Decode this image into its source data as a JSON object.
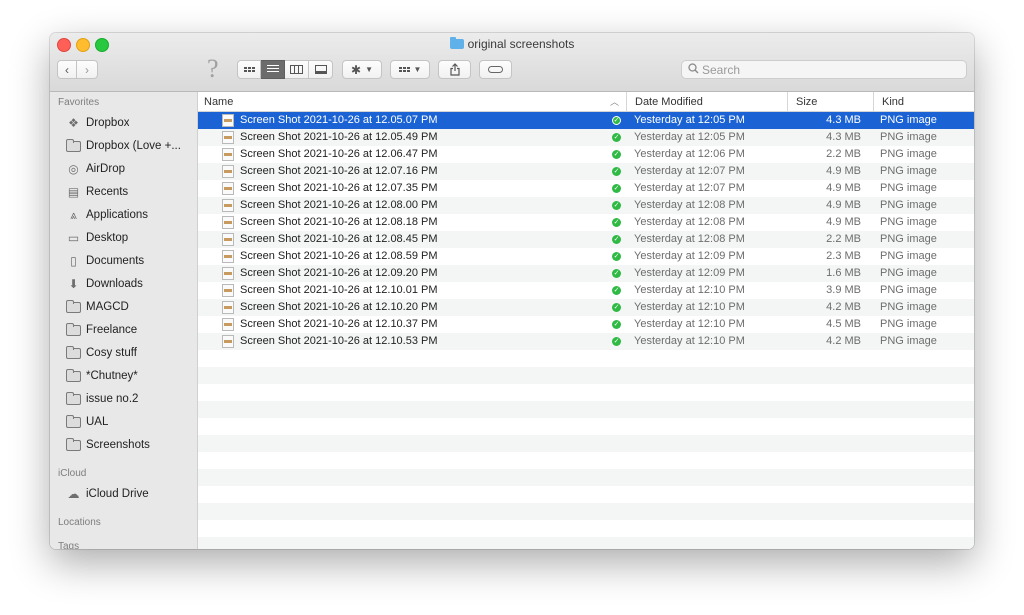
{
  "window": {
    "title": "original screenshots"
  },
  "toolbar": {
    "back_label": "‹",
    "forward_label": "›",
    "help_label": "?",
    "search_placeholder": "Search"
  },
  "sidebar": {
    "favorites_header": "Favorites",
    "favorites": [
      {
        "label": "Dropbox",
        "icon": "dropbox-icon"
      },
      {
        "label": "Dropbox (Love +...",
        "icon": "folder-icon"
      },
      {
        "label": "AirDrop",
        "icon": "airdrop-icon"
      },
      {
        "label": "Recents",
        "icon": "recents-icon"
      },
      {
        "label": "Applications",
        "icon": "applications-icon"
      },
      {
        "label": "Desktop",
        "icon": "desktop-icon"
      },
      {
        "label": "Documents",
        "icon": "documents-icon"
      },
      {
        "label": "Downloads",
        "icon": "downloads-icon"
      },
      {
        "label": "MAGCD",
        "icon": "folder-icon"
      },
      {
        "label": "Freelance",
        "icon": "folder-icon"
      },
      {
        "label": "Cosy stuff",
        "icon": "folder-icon"
      },
      {
        "label": "*Chutney*",
        "icon": "folder-icon"
      },
      {
        "label": "issue no.2",
        "icon": "folder-icon"
      },
      {
        "label": "UAL",
        "icon": "folder-icon"
      },
      {
        "label": "Screenshots",
        "icon": "folder-icon"
      }
    ],
    "icloud_header": "iCloud",
    "icloud": [
      {
        "label": "iCloud Drive",
        "icon": "cloud-icon"
      }
    ],
    "locations_header": "Locations",
    "tags_header": "Tags"
  },
  "columns": {
    "name": "Name",
    "date_modified": "Date Modified",
    "size": "Size",
    "kind": "Kind"
  },
  "files": [
    {
      "name": "Screen Shot 2021-10-26 at 12.05.07 PM",
      "date": "Yesterday at 12:05 PM",
      "size": "4.3 MB",
      "kind": "PNG image",
      "selected": true
    },
    {
      "name": "Screen Shot 2021-10-26 at 12.05.49 PM",
      "date": "Yesterday at 12:05 PM",
      "size": "4.3 MB",
      "kind": "PNG image"
    },
    {
      "name": "Screen Shot 2021-10-26 at 12.06.47 PM",
      "date": "Yesterday at 12:06 PM",
      "size": "2.2 MB",
      "kind": "PNG image"
    },
    {
      "name": "Screen Shot 2021-10-26 at 12.07.16 PM",
      "date": "Yesterday at 12:07 PM",
      "size": "4.9 MB",
      "kind": "PNG image"
    },
    {
      "name": "Screen Shot 2021-10-26 at 12.07.35 PM",
      "date": "Yesterday at 12:07 PM",
      "size": "4.9 MB",
      "kind": "PNG image"
    },
    {
      "name": "Screen Shot 2021-10-26 at 12.08.00 PM",
      "date": "Yesterday at 12:08 PM",
      "size": "4.9 MB",
      "kind": "PNG image"
    },
    {
      "name": "Screen Shot 2021-10-26 at 12.08.18 PM",
      "date": "Yesterday at 12:08 PM",
      "size": "4.9 MB",
      "kind": "PNG image"
    },
    {
      "name": "Screen Shot 2021-10-26 at 12.08.45 PM",
      "date": "Yesterday at 12:08 PM",
      "size": "2.2 MB",
      "kind": "PNG image"
    },
    {
      "name": "Screen Shot 2021-10-26 at 12.08.59 PM",
      "date": "Yesterday at 12:09 PM",
      "size": "2.3 MB",
      "kind": "PNG image"
    },
    {
      "name": "Screen Shot 2021-10-26 at 12.09.20 PM",
      "date": "Yesterday at 12:09 PM",
      "size": "1.6 MB",
      "kind": "PNG image"
    },
    {
      "name": "Screen Shot 2021-10-26 at 12.10.01 PM",
      "date": "Yesterday at 12:10 PM",
      "size": "3.9 MB",
      "kind": "PNG image"
    },
    {
      "name": "Screen Shot 2021-10-26 at 12.10.20 PM",
      "date": "Yesterday at 12:10 PM",
      "size": "4.2 MB",
      "kind": "PNG image"
    },
    {
      "name": "Screen Shot 2021-10-26 at 12.10.37 PM",
      "date": "Yesterday at 12:10 PM",
      "size": "4.5 MB",
      "kind": "PNG image"
    },
    {
      "name": "Screen Shot 2021-10-26 at 12.10.53 PM",
      "date": "Yesterday at 12:10 PM",
      "size": "4.2 MB",
      "kind": "PNG image"
    }
  ],
  "colors": {
    "selection": "#1b63d4",
    "synced": "#2fba44",
    "folder_accent": "#60b1ea"
  }
}
